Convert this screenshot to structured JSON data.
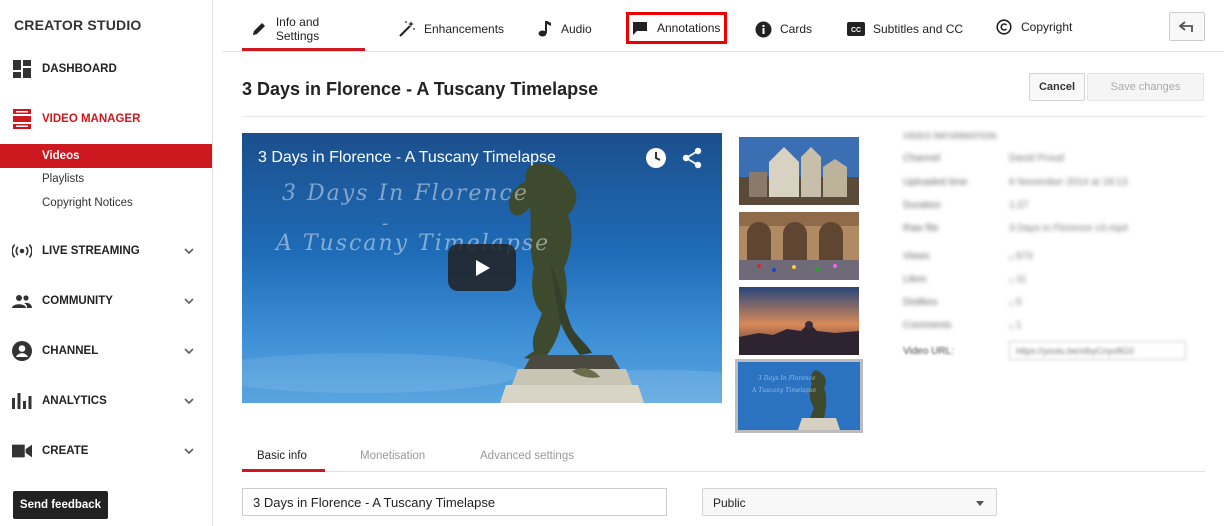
{
  "sidebar": {
    "brand": "CREATOR STUDIO",
    "dashboard": "DASHBOARD",
    "video_manager": "VIDEO MANAGER",
    "sub_items": [
      "Videos",
      "Playlists",
      "Copyright Notices"
    ],
    "live_streaming": "LIVE STREAMING",
    "community": "COMMUNITY",
    "channel": "CHANNEL",
    "analytics": "ANALYTICS",
    "create": "CREATE",
    "feedback": "Send feedback"
  },
  "tabs": {
    "info": "Info and Settings",
    "enhancements": "Enhancements",
    "audio": "Audio",
    "annotations": "Annotations",
    "cards": "Cards",
    "subtitles": "Subtitles and CC",
    "copyright": "Copyright"
  },
  "header": {
    "video_title": "3 Days in Florence - A Tuscany Timelapse",
    "cancel": "Cancel",
    "save": "Save changes"
  },
  "player": {
    "title": "3 Days in Florence - A Tuscany Timelapse",
    "overlay_line1": "3 Days In Florence",
    "overlay_line2": "-",
    "overlay_line3": "A Tuscany Timelapse"
  },
  "video_info": {
    "heading": "VIDEO INFORMATION",
    "rows": [
      {
        "k": "Channel",
        "v": "David Proud"
      },
      {
        "k": "Uploaded time",
        "v": "6 November 2014 at 18:13"
      },
      {
        "k": "Duration",
        "v": "1:27"
      },
      {
        "k": "Raw file",
        "v": "3 Days in Florence v3.mp4"
      },
      {
        "k": "Views",
        "v": "₀   673"
      },
      {
        "k": "Likes",
        "v": "₀   11"
      },
      {
        "k": "Dislikes",
        "v": "₀   0"
      },
      {
        "k": "Comments",
        "v": "₀   1"
      }
    ],
    "url_label": "Video URL:",
    "url_value": "https://youtu.be/xlbyCnyo8G0"
  },
  "subtabs": [
    "Basic info",
    "Monetisation",
    "Advanced settings"
  ],
  "form": {
    "title_value": "3 Days in Florence - A Tuscany Timelapse",
    "privacy": "Public"
  },
  "colors": {
    "accent": "#cc181e",
    "annotation_outline": "#ee0000"
  }
}
